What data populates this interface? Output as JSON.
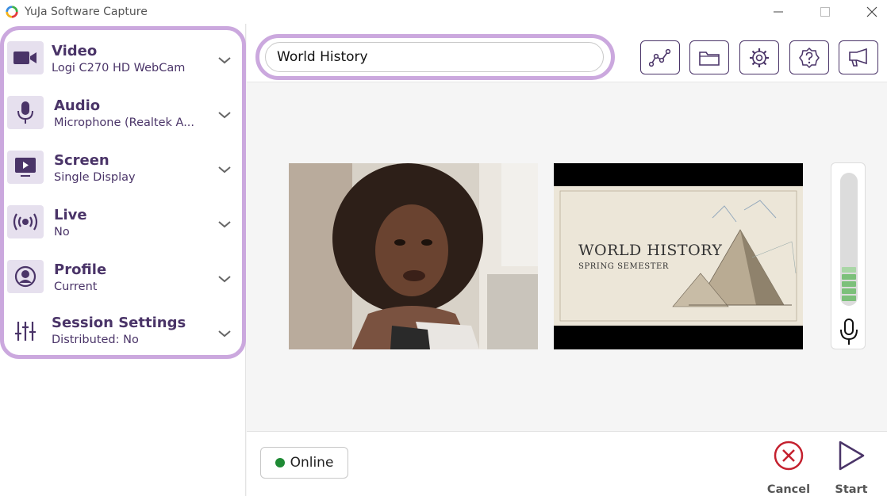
{
  "window": {
    "title": "YuJa Software Capture",
    "accent": "#cba8de",
    "brand": "#4a3468"
  },
  "sources": [
    {
      "title": "Video",
      "subtitle": "Logi C270 HD WebCam",
      "icon": "video-camera-icon"
    },
    {
      "title": "Audio",
      "subtitle": "Microphone (Realtek A...",
      "icon": "microphone-icon"
    },
    {
      "title": "Screen",
      "subtitle": "Single Display",
      "icon": "screen-play-icon"
    },
    {
      "title": "Live",
      "subtitle": "No",
      "icon": "broadcast-icon"
    },
    {
      "title": "Profile",
      "subtitle": "Current",
      "icon": "user-circle-icon"
    },
    {
      "title": "Session Settings",
      "subtitle": "Distributed: No",
      "icon": "sliders-icon"
    }
  ],
  "session": {
    "title_value": "World History"
  },
  "toolbar": {
    "icons": [
      "analytics-icon",
      "folder-icon",
      "gear-icon",
      "help-icon",
      "announcement-icon"
    ]
  },
  "preview": {
    "slide_title": "WORLD HISTORY",
    "slide_subtitle": "SPRING SEMESTER",
    "audio_level_fraction": 0.28
  },
  "status": {
    "label": "Online",
    "color": "#1e8a34"
  },
  "actions": {
    "cancel_label": "Cancel",
    "start_label": "Start",
    "cancel_color": "#c4202e"
  }
}
